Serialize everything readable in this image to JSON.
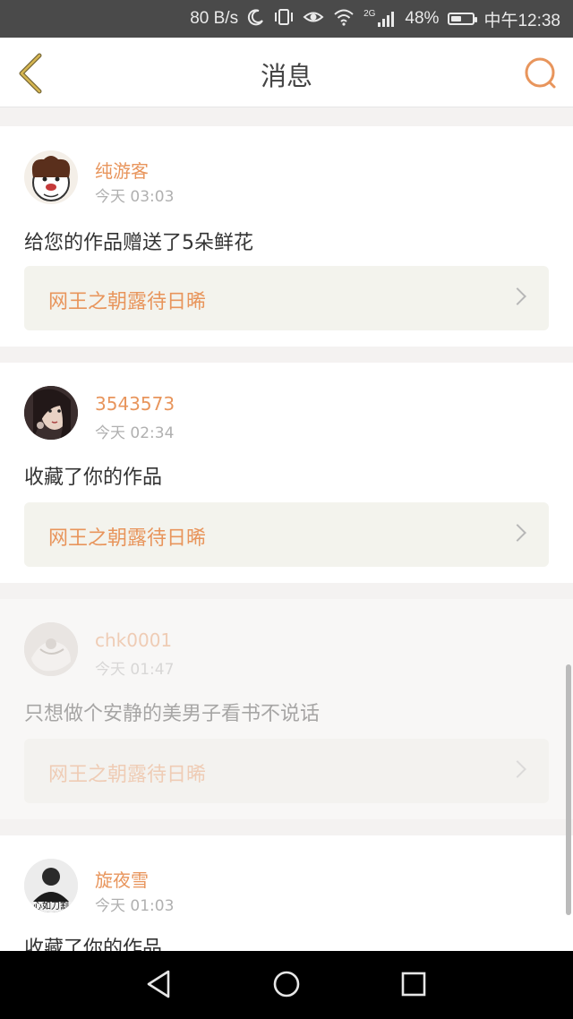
{
  "status_bar": {
    "speed": "80 B/s",
    "icons": [
      "moon-icon",
      "vibrate-icon",
      "eye-icon",
      "wifi-icon",
      "signal-icon"
    ],
    "network_type": "2G",
    "battery": "48%",
    "battery_level": 0.48,
    "time": "中午12:38"
  },
  "header": {
    "title": "消息",
    "back_icon": "chevron-left-icon",
    "search_icon": "search-icon",
    "accent_color": "#e8955c"
  },
  "messages": [
    {
      "user": "纯游客",
      "time": "今天 03:03",
      "text": "给您的作品赠送了5朵鲜花",
      "work": "网王之朝露待日晞"
    },
    {
      "user": "3543573",
      "time": "今天 02:34",
      "text": "收藏了你的作品",
      "work": "网王之朝露待日晞"
    },
    {
      "user": "chk0001",
      "time": "今天 01:47",
      "text": "只想做个安静的美男子看书不说话",
      "work": "网王之朝露待日晞"
    },
    {
      "user": "旋夜雪",
      "time": "今天 01:03",
      "text": "收藏了你的作品",
      "avatar_caption": "心如刀割"
    }
  ],
  "nav_bar": {
    "icons": [
      "back-triangle-icon",
      "home-circle-icon",
      "recents-square-icon"
    ]
  }
}
